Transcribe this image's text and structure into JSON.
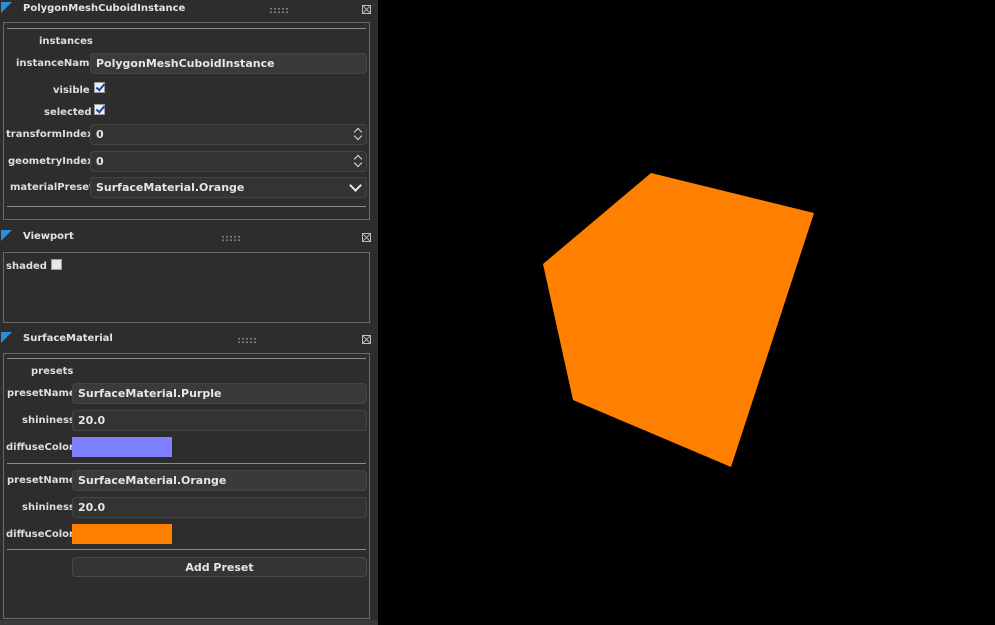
{
  "panels": {
    "instance": {
      "title": "PolygonMeshCuboidInstance",
      "section_label": "instances",
      "fields": {
        "instanceName_label": "instanceName",
        "instanceName_value": "PolygonMeshCuboidInstance",
        "visible_label": "visible",
        "visible_checked": true,
        "selected_label": "selected",
        "selected_checked": true,
        "transformIndex_label": "transformIndex",
        "transformIndex_value": "0",
        "geometryIndex_label": "geometryIndex",
        "geometryIndex_value": "0",
        "materialPreset_label": "materialPreset",
        "materialPreset_value": "SurfaceMaterial.Orange"
      }
    },
    "viewport": {
      "title": "Viewport",
      "shaded_label": "shaded",
      "shaded_checked": false
    },
    "surface_material": {
      "title": "SurfaceMaterial",
      "section_label": "presets",
      "presets": [
        {
          "presetName_label": "presetName",
          "presetName_value": "SurfaceMaterial.Purple",
          "shininess_label": "shininess",
          "shininess_value": "20.0",
          "diffuseColor_label": "diffuseColor",
          "diffuseColor": "#8080ff"
        },
        {
          "presetName_label": "presetName",
          "presetName_value": "SurfaceMaterial.Orange",
          "shininess_label": "shininess",
          "shininess_value": "20.0",
          "diffuseColor_label": "diffuseColor",
          "diffuseColor": "#ff8000"
        }
      ],
      "add_button": "Add Preset"
    }
  },
  "scene": {
    "background": "#000000",
    "cube_color": "#ff8000"
  },
  "icons": {
    "panel_corner": "blue-triangle-icon",
    "grip": "drag-grip-icon",
    "close": "close-icon",
    "spinner": "spinner-arrows-icon",
    "dropdown": "chevron-down-icon",
    "checkbox": "checkbox-icon"
  }
}
